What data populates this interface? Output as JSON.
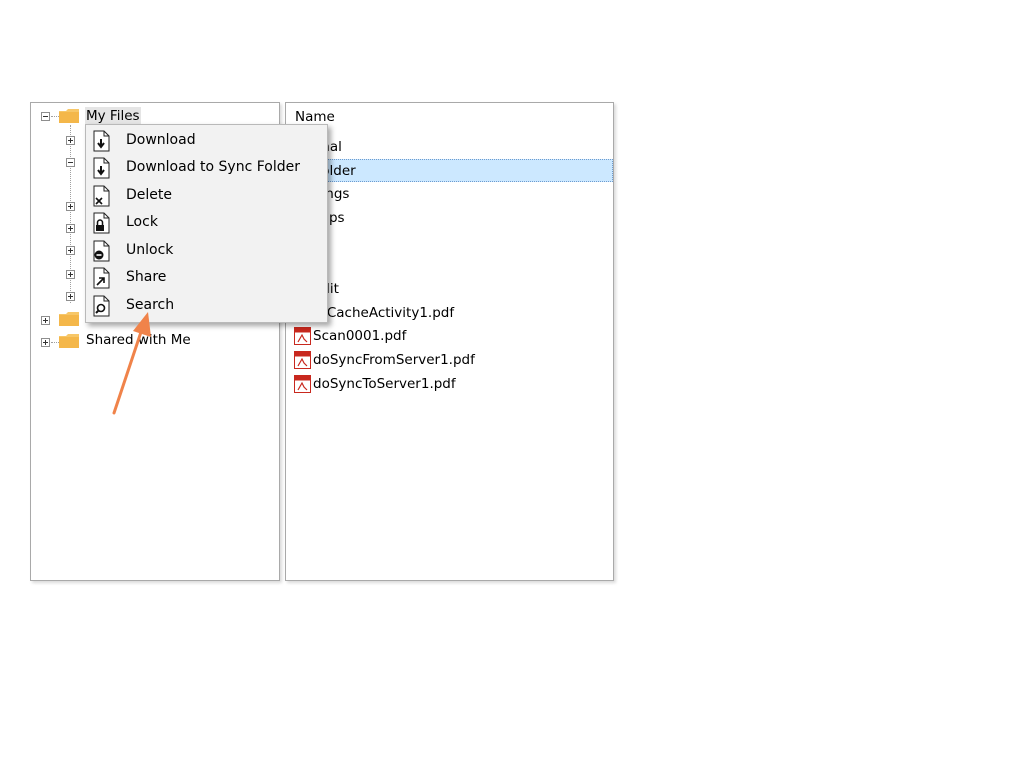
{
  "tree": {
    "items": [
      {
        "label": "My Files",
        "expanded": true
      },
      {
        "label": "Shared with Me",
        "expanded": false
      }
    ]
  },
  "file_list": {
    "column_header": "Name",
    "rows": [
      {
        "name": "onal",
        "type": "folder",
        "selected": false
      },
      {
        "name": "Folder",
        "type": "folder",
        "selected": true
      },
      {
        "name": "hings",
        "type": "folder",
        "selected": false
      },
      {
        "name": "kups",
        "type": "folder",
        "selected": false
      },
      {
        "name": "p",
        "type": "folder",
        "selected": false
      },
      {
        "name": "",
        "type": "folder",
        "selected": false
      },
      {
        "name": "edit",
        "type": "folder",
        "selected": false
      },
      {
        "name": "erCacheActivity1.pdf",
        "type": "pdf",
        "selected": false
      },
      {
        "name": "Scan0001.pdf",
        "type": "pdf",
        "selected": false
      },
      {
        "name": "doSyncFromServer1.pdf",
        "type": "pdf",
        "selected": false
      },
      {
        "name": "doSyncToServer1.pdf",
        "type": "pdf",
        "selected": false
      }
    ]
  },
  "context_menu": {
    "items": [
      {
        "label": "Download",
        "icon": "download-icon"
      },
      {
        "label": "Download to Sync Folder",
        "icon": "download-sync-icon"
      },
      {
        "label": "Delete",
        "icon": "delete-icon"
      },
      {
        "label": "Lock",
        "icon": "lock-icon"
      },
      {
        "label": "Unlock",
        "icon": "unlock-icon"
      },
      {
        "label": "Share",
        "icon": "share-icon"
      },
      {
        "label": "Search",
        "icon": "search-icon"
      }
    ]
  },
  "colors": {
    "selection_bg": "#cce8ff",
    "folder": "#f7c768",
    "pdf_red": "#c8281e",
    "arrow": "#f0834a",
    "menu_bg": "#f2f2f2"
  }
}
